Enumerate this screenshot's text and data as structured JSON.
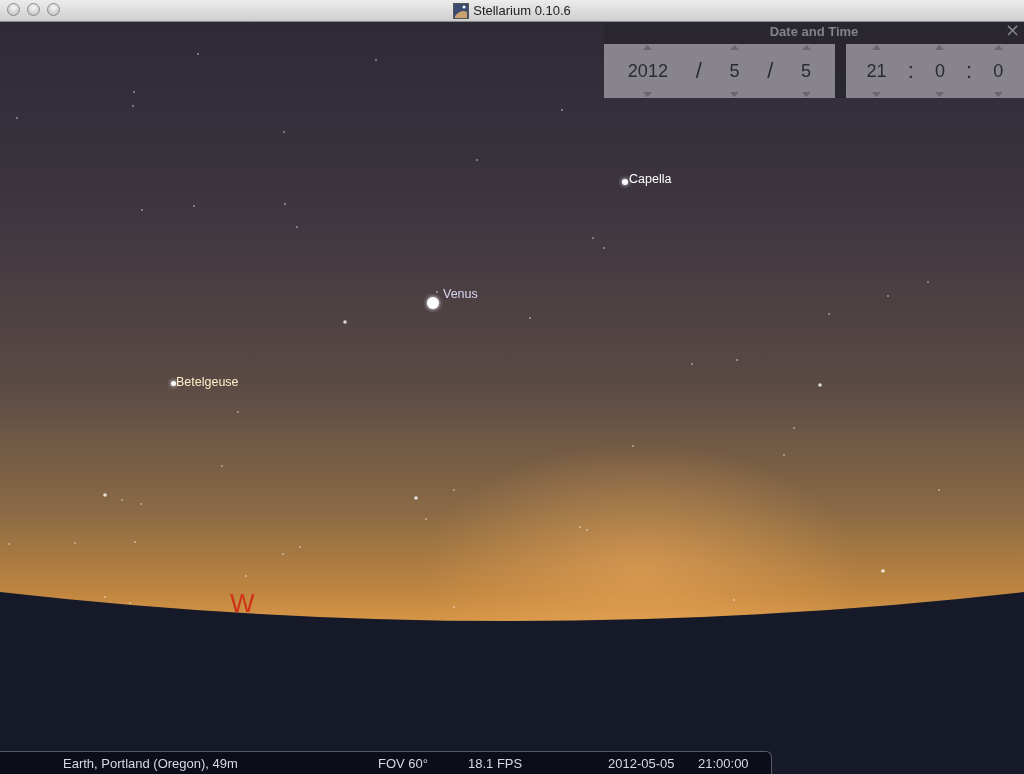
{
  "window": {
    "title": "Stellarium 0.10.6"
  },
  "sky": {
    "objects": [
      {
        "name": "Capella",
        "color": "#ffffff"
      },
      {
        "name": "Venus",
        "color": "#d8d8f4"
      },
      {
        "name": "Betelgeuse",
        "color": "#fff0c8"
      }
    ],
    "cardinal": "W"
  },
  "date_time_dialog": {
    "title": "Date and Time",
    "close": "×",
    "date": [
      {
        "value": "2012"
      },
      {
        "sep": "/"
      },
      {
        "value": "5"
      },
      {
        "sep": "/"
      },
      {
        "value": "5"
      }
    ],
    "time": [
      {
        "value": "21"
      },
      {
        "sep": ":"
      },
      {
        "value": "0"
      },
      {
        "sep": ":"
      },
      {
        "value": "0"
      }
    ]
  },
  "status_bar": {
    "location": "Earth, Portland (Oregon), 49m",
    "fov": "FOV 60°",
    "fps": "18.1 FPS",
    "date": "2012-05-05",
    "time": "21:00:00"
  }
}
